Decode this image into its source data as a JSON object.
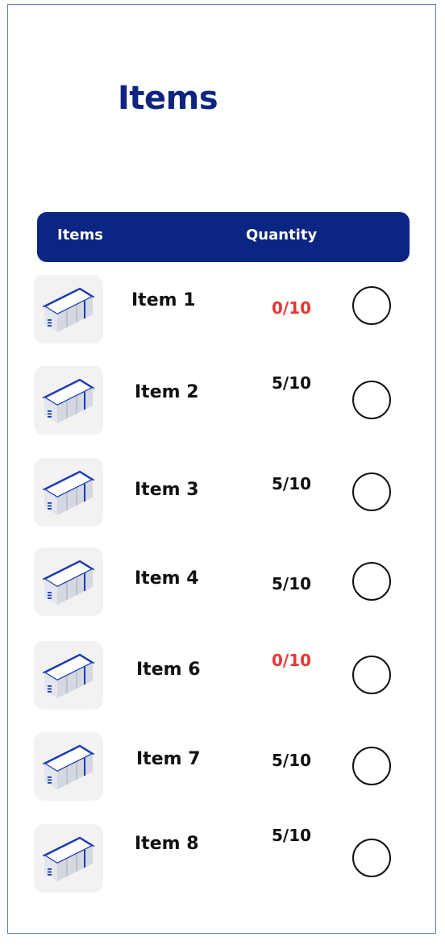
{
  "page": {
    "title": "Items"
  },
  "table": {
    "headers": {
      "items": "Items",
      "quantity": "Quantity"
    },
    "rows": [
      {
        "name": "Item 1",
        "quantity": "0/10",
        "status": "empty",
        "checked": false
      },
      {
        "name": "Item 2",
        "quantity": "5/10",
        "status": "partial",
        "checked": false
      },
      {
        "name": "Item 3",
        "quantity": "5/10",
        "status": "partial",
        "checked": false
      },
      {
        "name": "Item 4",
        "quantity": "5/10",
        "status": "partial",
        "checked": false
      },
      {
        "name": "Item 6",
        "quantity": "0/10",
        "status": "empty",
        "checked": false
      },
      {
        "name": "Item 7",
        "quantity": "5/10",
        "status": "partial",
        "checked": false
      },
      {
        "name": "Item 8",
        "quantity": "5/10",
        "status": "partial",
        "checked": false
      }
    ]
  },
  "icons": {
    "item_thumbnail": "container-box-icon",
    "row_select": "circle-checkbox"
  },
  "colors": {
    "primary": "#0b2583",
    "border": "#5a7fc7",
    "empty_quantity": "#e53935",
    "text": "#111111",
    "thumbnail_bg": "#f2f2f2"
  }
}
